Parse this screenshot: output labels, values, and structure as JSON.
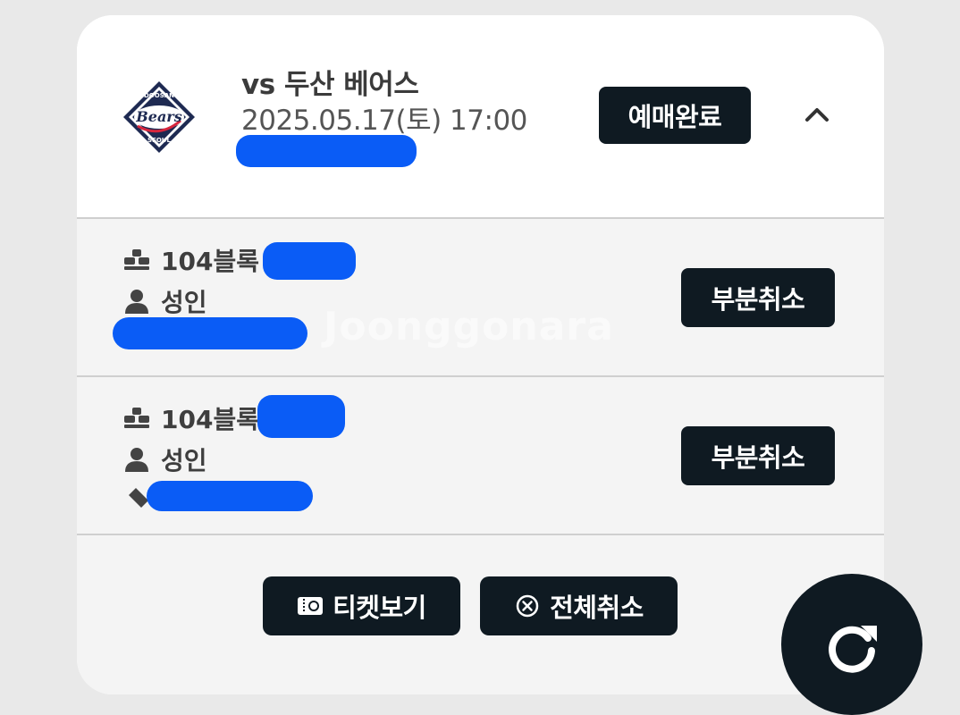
{
  "game": {
    "opponent": "vs 두산 베어스",
    "datetime": "2025.05.17(토) 17:00",
    "status": "예매완료",
    "logo": {
      "icon": "bears-logo",
      "top_text": "DOOSAN",
      "main_text": "Bears",
      "bottom_text": "SEOUL"
    }
  },
  "tickets": [
    {
      "block": "104블록 1",
      "ticket_type": "성인",
      "partial_cancel_label": "부분취소"
    },
    {
      "block": "104블록 1",
      "ticket_type": "성인",
      "partial_cancel_label": "부분취소"
    }
  ],
  "actions": {
    "view_tickets": "티켓보기",
    "cancel_all": "전체취소"
  },
  "watermark": "Joonggonara",
  "icons": {
    "seat": "seat-icon",
    "person": "person-icon",
    "ticket": "ticket-icon",
    "collapse": "chevron-up-icon",
    "view": "ticket-view-icon",
    "cancel": "circle-x-icon",
    "refresh": "refresh-icon"
  },
  "colors": {
    "button_bg": "#0f1a22",
    "redaction": "#0a5cf6",
    "row_bg": "#f4f4f4"
  }
}
